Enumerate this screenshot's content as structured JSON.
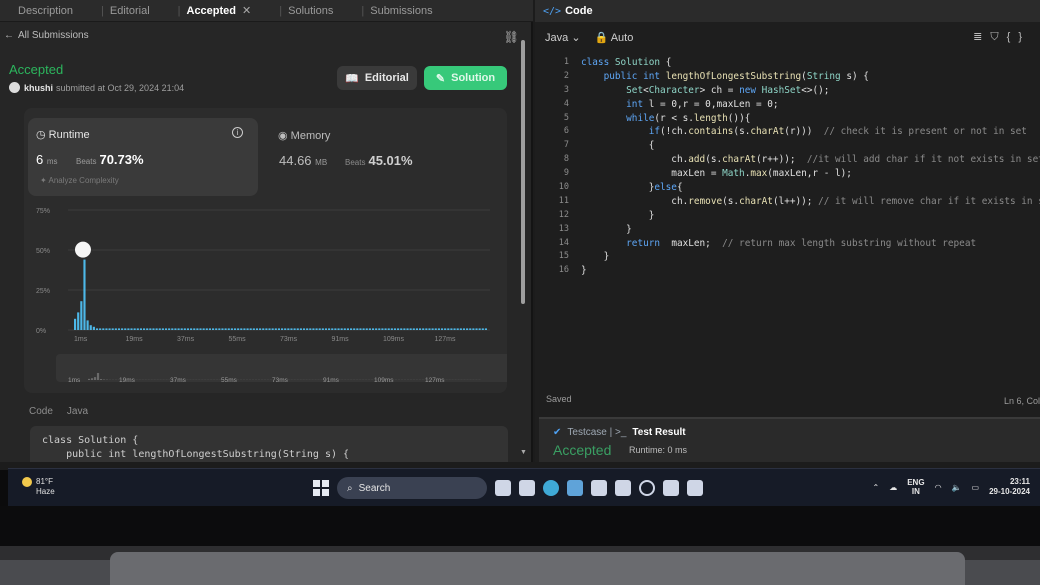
{
  "tabs": {
    "description": "Description",
    "editorial": "Editorial",
    "accepted": "Accepted",
    "solutions": "Solutions",
    "submissions": "Submissions"
  },
  "back": "All Submissions",
  "submission": {
    "status": "Accepted",
    "user": "khushi",
    "submitted_text": "submitted at Oct 29, 2024 21:04"
  },
  "buttons": {
    "editorial": "Editorial",
    "solution": "Solution"
  },
  "runtime": {
    "label": "Runtime",
    "value": "6",
    "unit": "ms",
    "beats_label": "Beats",
    "beats": "70.73%",
    "analyze": "Analyze Complexity"
  },
  "memory": {
    "label": "Memory",
    "value": "44.66",
    "unit": "MB",
    "beats_label": "Beats",
    "beats": "45.01%"
  },
  "chart_data": {
    "type": "bar",
    "yticks": [
      "75%",
      "50%",
      "25%",
      "0%"
    ],
    "ylim": [
      0,
      75
    ],
    "x_labels": [
      "1ms",
      "19ms",
      "37ms",
      "55ms",
      "73ms",
      "91ms",
      "109ms",
      "127ms"
    ],
    "values": [
      7,
      11,
      18,
      44,
      6,
      3,
      2,
      1,
      1,
      1,
      1,
      1,
      1,
      1,
      1,
      1,
      1,
      1,
      1,
      1,
      1,
      1,
      1,
      1,
      1,
      1,
      1,
      1,
      1,
      1,
      1,
      1,
      1,
      1,
      1,
      1,
      1,
      1,
      1,
      1,
      1,
      1,
      1,
      1,
      1,
      1,
      1,
      1,
      1,
      1,
      1,
      1,
      1,
      1,
      1,
      1,
      1,
      1,
      1,
      1,
      1,
      1,
      1,
      1,
      1,
      1,
      1,
      1,
      1,
      1,
      1,
      1,
      1,
      1,
      1,
      1,
      1,
      1,
      1,
      1,
      1,
      1,
      1,
      1,
      1,
      1,
      1,
      1,
      1,
      1,
      1,
      1,
      1,
      1,
      1,
      1,
      1,
      1,
      1,
      1,
      1,
      1,
      1,
      1,
      1,
      1,
      1,
      1,
      1,
      1,
      1,
      1,
      1,
      1,
      1,
      1,
      1,
      1,
      1,
      1,
      1,
      1,
      1,
      1,
      1,
      1,
      1,
      1,
      1,
      1,
      1,
      1
    ],
    "highlight_index": 3,
    "bar_color": "#4db8e8"
  },
  "code_section": {
    "tab_code": "Code",
    "tab_lang": "Java",
    "preview_line1": "class Solution {",
    "preview_line2": "    public int lengthOfLongestSubstring(String s) {"
  },
  "editor": {
    "header": "Code",
    "language": "Java",
    "mode": "Auto",
    "lines": [
      {
        "n": "1",
        "t": "class Solution {"
      },
      {
        "n": "2",
        "t": "    public int lengthOfLongestSubstring(String s) {"
      },
      {
        "n": "3",
        "t": "        Set<Character> ch = new HashSet<>();"
      },
      {
        "n": "4",
        "t": "        int l = 0,r = 0,maxLen = 0;"
      },
      {
        "n": "5",
        "t": "        while(r < s.length()){"
      },
      {
        "n": "6",
        "t": "            if(!ch.contains(s.charAt(r)))  // check it is present or not in set"
      },
      {
        "n": "7",
        "t": "            {"
      },
      {
        "n": "8",
        "t": "                ch.add(s.charAt(r++));  //it will add char if it not exists in set"
      },
      {
        "n": "9",
        "t": "                maxLen = Math.max(maxLen,r - l);"
      },
      {
        "n": "10",
        "t": "            }else{"
      },
      {
        "n": "11",
        "t": "                ch.remove(s.charAt(l++)); // it will remove char if it exists in s"
      },
      {
        "n": "12",
        "t": "            }"
      },
      {
        "n": "13",
        "t": "        }"
      },
      {
        "n": "14",
        "t": "        return  maxLen;  // return max length substring without repeat"
      },
      {
        "n": "15",
        "t": "    }"
      },
      {
        "n": "16",
        "t": "}"
      }
    ],
    "saved": "Saved",
    "position": "Ln 6, Col"
  },
  "test": {
    "testcase": "Testcase",
    "result": "Test Result",
    "status": "Accepted",
    "runtime": "Runtime: 0 ms"
  },
  "taskbar": {
    "temp": "81°F",
    "weather": "Haze",
    "search": "Search",
    "lang1": "ENG",
    "lang2": "IN",
    "time": "23:11",
    "date": "29-10-2024"
  }
}
